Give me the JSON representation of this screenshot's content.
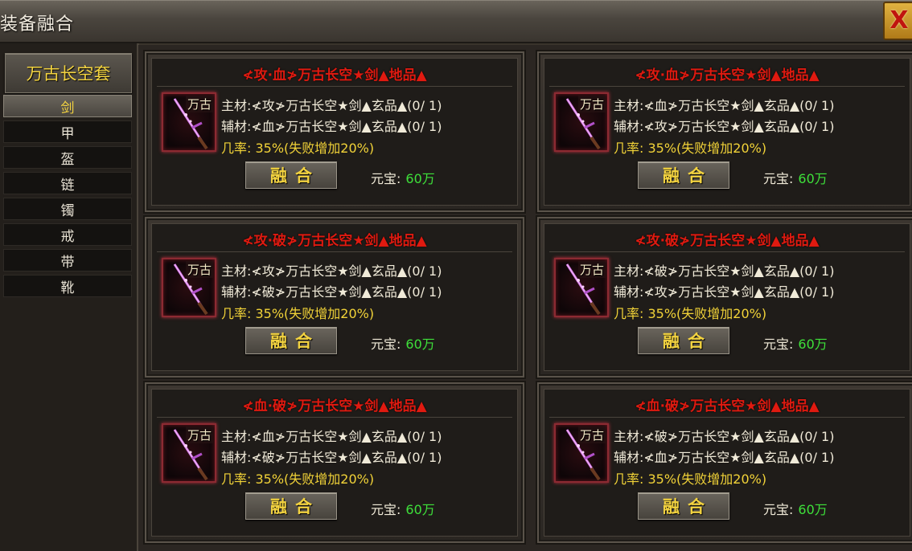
{
  "window": {
    "title": "装备融合",
    "close_label": "X"
  },
  "sidebar": {
    "set_name": "万古长空套",
    "items": [
      {
        "label": "剑",
        "active": true
      },
      {
        "label": "甲",
        "active": false
      },
      {
        "label": "盔",
        "active": false
      },
      {
        "label": "链",
        "active": false
      },
      {
        "label": "镯",
        "active": false
      },
      {
        "label": "戒",
        "active": false
      },
      {
        "label": "带",
        "active": false
      },
      {
        "label": "靴",
        "active": false
      }
    ]
  },
  "cards": [
    {
      "title": "≮攻·血≯万古长空★剑▲地品▲",
      "icon_tag": "万古",
      "main_material": "主材:≮攻≯万古长空★剑▲玄品▲(0/ 1)",
      "aux_material": "辅材:≮血≯万古长空★剑▲玄品▲(0/ 1)",
      "rate": "几率:  35%(失败增加20%)",
      "fuse_label": "融合",
      "yuanbao_label": "元宝:",
      "yuanbao_amount": "60万"
    },
    {
      "title": "≮攻·血≯万古长空★剑▲地品▲",
      "icon_tag": "万古",
      "main_material": "主材:≮血≯万古长空★剑▲玄品▲(0/ 1)",
      "aux_material": "辅材:≮攻≯万古长空★剑▲玄品▲(0/ 1)",
      "rate": "几率:  35%(失败增加20%)",
      "fuse_label": "融合",
      "yuanbao_label": "元宝:",
      "yuanbao_amount": "60万"
    },
    {
      "title": "≮攻·破≯万古长空★剑▲地品▲",
      "icon_tag": "万古",
      "main_material": "主材:≮攻≯万古长空★剑▲玄品▲(0/ 1)",
      "aux_material": "辅材:≮破≯万古长空★剑▲玄品▲(0/ 1)",
      "rate": "几率:  35%(失败增加20%)",
      "fuse_label": "融合",
      "yuanbao_label": "元宝:",
      "yuanbao_amount": "60万"
    },
    {
      "title": "≮攻·破≯万古长空★剑▲地品▲",
      "icon_tag": "万古",
      "main_material": "主材:≮破≯万古长空★剑▲玄品▲(0/ 1)",
      "aux_material": "辅材:≮攻≯万古长空★剑▲玄品▲(0/ 1)",
      "rate": "几率:  35%(失败增加20%)",
      "fuse_label": "融合",
      "yuanbao_label": "元宝:",
      "yuanbao_amount": "60万"
    },
    {
      "title": "≮血·破≯万古长空★剑▲地品▲",
      "icon_tag": "万古",
      "main_material": "主材:≮血≯万古长空★剑▲玄品▲(0/ 1)",
      "aux_material": "辅材:≮破≯万古长空★剑▲玄品▲(0/ 1)",
      "rate": "几率:  35%(失败增加20%)",
      "fuse_label": "融合",
      "yuanbao_label": "元宝:",
      "yuanbao_amount": "60万"
    },
    {
      "title": "≮血·破≯万古长空★剑▲地品▲",
      "icon_tag": "万古",
      "main_material": "主材:≮破≯万古长空★剑▲玄品▲(0/ 1)",
      "aux_material": "辅材:≮血≯万古长空★剑▲玄品▲(0/ 1)",
      "rate": "几率:  35%(失败增加20%)",
      "fuse_label": "融合",
      "yuanbao_label": "元宝:",
      "yuanbao_amount": "60万"
    }
  ],
  "colors": {
    "title_red": "#e01a10",
    "rate_yellow": "#f2d338",
    "amount_green": "#3ee03a",
    "button_gold_text": "#f3d340"
  }
}
